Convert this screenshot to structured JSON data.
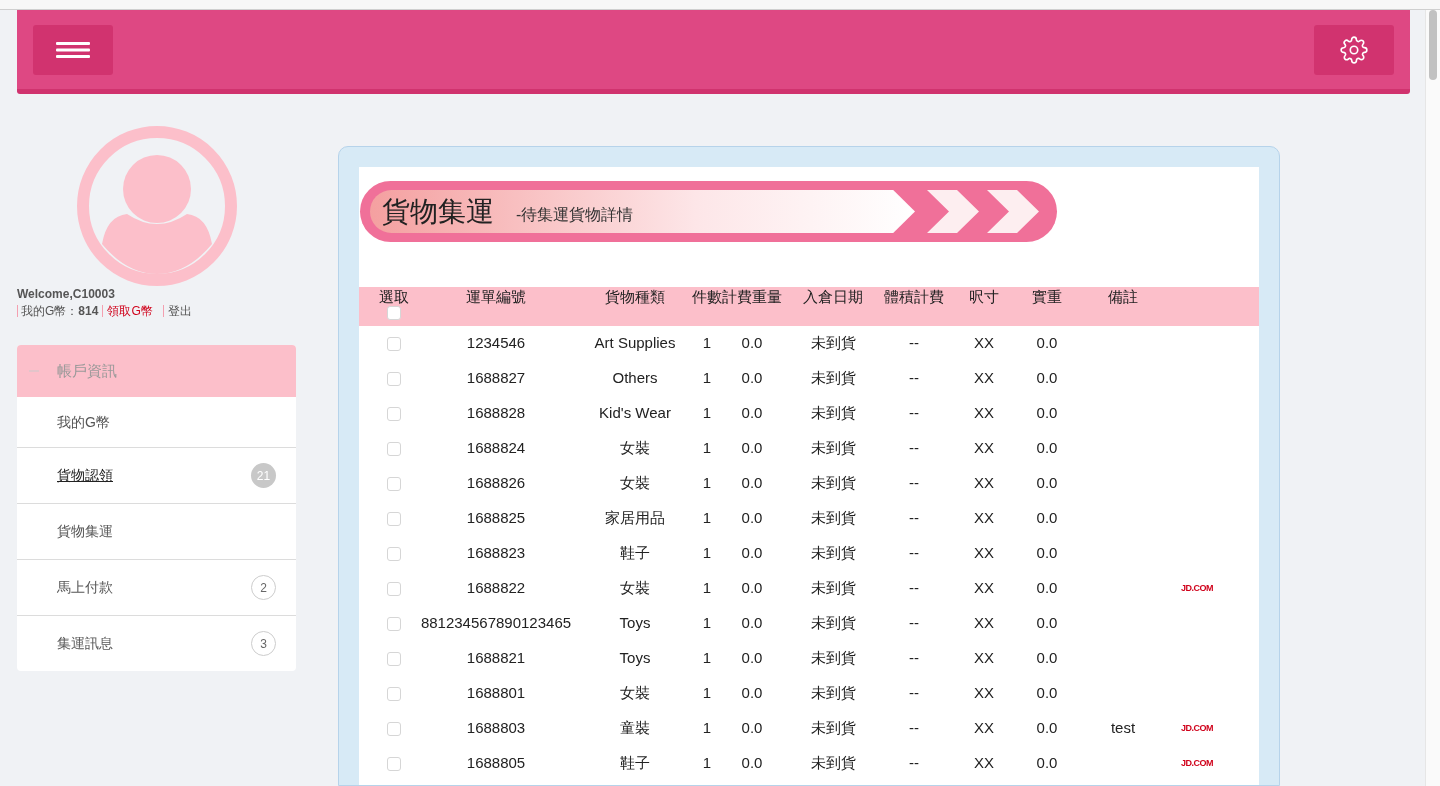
{
  "profile": {
    "welcome": "Welcome,C10003",
    "coins": "我的G幣：**814**",
    "claim_link": "領取G幣",
    "logout_link": "登出"
  },
  "menu": {
    "title": "帳戶資訊",
    "expanded": true,
    "items": [
      {
        "label": "我的G幣",
        "selected": false
      },
      {
        "label": "貨物認領",
        "selected": true,
        "badge": "21",
        "kind": "filled"
      },
      {
        "label": "貨物集運",
        "selected": false
      },
      {
        "label": "馬上付款",
        "selected": false,
        "badge": "2",
        "kind": "outline"
      },
      {
        "label": "集運訊息",
        "selected": false,
        "badge": "3",
        "kind": "outline"
      }
    ]
  },
  "banner": {
    "title": "貨物集運",
    "subtitle": "-待集運貨物詳情"
  },
  "table": {
    "select_all": {
      "label": "選取",
      "checked": false
    },
    "columns": [
      "運單編號",
      "貨物種類",
      "件數",
      "計費重量",
      "入倉日期",
      "體積計費",
      "呎寸",
      "實重",
      "備註"
    ],
    "rows": [
      {
        "checked": false,
        "cells": [
          "1234546",
          "Art Supplies",
          "1",
          "0.0",
          "未到貨",
          "--",
          "XX",
          "0.0"
        ]
      },
      {
        "checked": false,
        "cells": [
          "1688827",
          "Others",
          "1",
          "0.0",
          "未到貨",
          "--",
          "XX",
          "0.0"
        ]
      },
      {
        "checked": false,
        "cells": [
          "1688828",
          "Kid's Wear",
          "1",
          "0.0",
          "未到貨",
          "--",
          "XX",
          "0.0"
        ]
      },
      {
        "checked": false,
        "cells": [
          "1688824",
          "女裝",
          "1",
          "0.0",
          "未到貨",
          "--",
          "XX",
          "0.0"
        ]
      },
      {
        "checked": false,
        "cells": [
          "1688826",
          "女裝",
          "1",
          "0.0",
          "未到貨",
          "--",
          "XX",
          "0.0"
        ]
      },
      {
        "checked": false,
        "cells": [
          "1688825",
          "家居用品",
          "1",
          "0.0",
          "未到貨",
          "--",
          "XX",
          "0.0"
        ]
      },
      {
        "checked": false,
        "cells": [
          "1688823",
          "鞋子",
          "1",
          "0.0",
          "未到貨",
          "--",
          "XX",
          "0.0"
        ]
      },
      {
        "checked": false,
        "cells": [
          "1688822",
          "女裝",
          "1",
          "0.0",
          "未到貨",
          "--",
          "XX",
          "0.0"
        ],
        "store": "JD.COM"
      },
      {
        "checked": false,
        "cells": [
          "881234567890123465",
          "Toys",
          "1",
          "0.0",
          "未到貨",
          "--",
          "XX",
          "0.0"
        ]
      },
      {
        "checked": false,
        "cells": [
          "1688821",
          "Toys",
          "1",
          "0.0",
          "未到貨",
          "--",
          "XX",
          "0.0"
        ]
      },
      {
        "checked": false,
        "cells": [
          "1688801",
          "女裝",
          "1",
          "0.0",
          "未到貨",
          "--",
          "XX",
          "0.0"
        ]
      },
      {
        "checked": false,
        "cells": [
          "1688803",
          "童裝",
          "1",
          "0.0",
          "未到貨",
          "--",
          "XX",
          "0.0"
        ],
        "remark": "test",
        "store": "JD.COM"
      },
      {
        "checked": false,
        "cells": [
          "1688805",
          "鞋子",
          "1",
          "0.0",
          "未到貨",
          "--",
          "XX",
          "0.0"
        ],
        "store": "JD.COM"
      }
    ]
  }
}
